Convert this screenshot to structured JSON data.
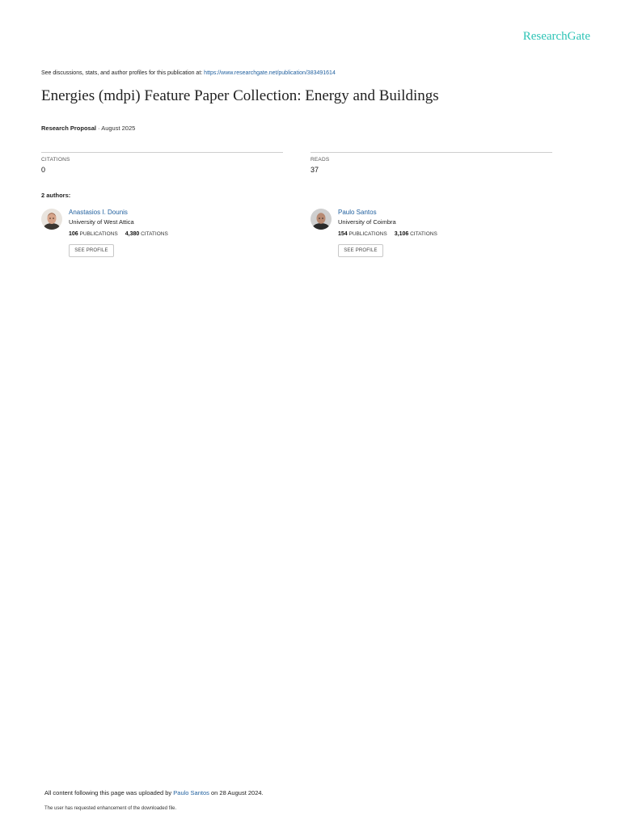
{
  "brand": {
    "logo_text": "ResearchGate",
    "accent_color": "#2ec4b6",
    "link_color": "#1f5f9e"
  },
  "header": {
    "see_prefix": "See discussions, stats, and author profiles for this publication at: ",
    "publication_url": "https://www.researchgate.net/publication/383491614"
  },
  "publication": {
    "title": "Energies (mdpi) Feature Paper Collection: Energy and Buildings",
    "type": "Research Proposal",
    "date": " · August 2025"
  },
  "stats": {
    "citations_label": "CITATIONS",
    "citations_value": "0",
    "reads_label": "READS",
    "reads_value": "37"
  },
  "authors_heading": "2 authors:",
  "authors": [
    {
      "name": "Anastasios I. Dounis",
      "affiliation": "University of West Attica",
      "publications": "106",
      "publications_label": "PUBLICATIONS",
      "citations": "4,380",
      "citations_label": "CITATIONS",
      "button": "SEE PROFILE"
    },
    {
      "name": "Paulo Santos",
      "affiliation": "University of Coimbra",
      "publications": "154",
      "publications_label": "PUBLICATIONS",
      "citations": "3,106",
      "citations_label": "CITATIONS",
      "button": "SEE PROFILE"
    }
  ],
  "footer": {
    "uploaded_prefix": "All content following this page was uploaded by ",
    "uploader": "Paulo Santos",
    "uploaded_suffix": " on 28 August 2024.",
    "note": "The user has requested enhancement of the downloaded file."
  }
}
